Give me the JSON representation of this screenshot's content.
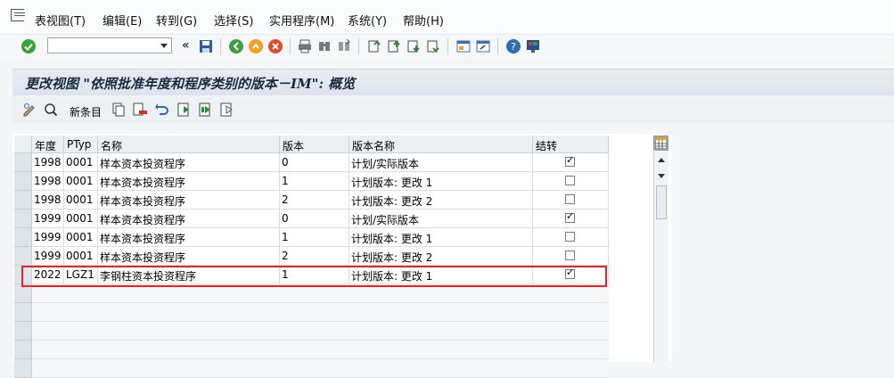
{
  "menu": [
    "表视图(T)",
    "编辑(E)",
    "转到(G)",
    "选择(S)",
    "实用程序(M)",
    "系统(Y)",
    "帮助(H)"
  ],
  "toolbar": {
    "back_chevron": "«"
  },
  "title": "更改视图 \"依照批准年度和程序类别的版本－IM\": 概览",
  "app_toolbar": {
    "new_entries": "新条目"
  },
  "table": {
    "headers": [
      "年度",
      "PTyp",
      "名称",
      "版本",
      "版本名称",
      "结转"
    ],
    "rows": [
      {
        "year": "1998",
        "ptyp": "0001",
        "name": "样本资本投资程序",
        "version": "0",
        "version_name": "计划/实际版本",
        "carry": true
      },
      {
        "year": "1998",
        "ptyp": "0001",
        "name": "样本资本投资程序",
        "version": "1",
        "version_name": "计划版本: 更改 1",
        "carry": false
      },
      {
        "year": "1998",
        "ptyp": "0001",
        "name": "样本资本投资程序",
        "version": "2",
        "version_name": "计划版本: 更改 2",
        "carry": false
      },
      {
        "year": "1999",
        "ptyp": "0001",
        "name": "样本资本投资程序",
        "version": "0",
        "version_name": "计划/实际版本",
        "carry": true
      },
      {
        "year": "1999",
        "ptyp": "0001",
        "name": "样本资本投资程序",
        "version": "1",
        "version_name": "计划版本: 更改 1",
        "carry": false
      },
      {
        "year": "1999",
        "ptyp": "0001",
        "name": "样本资本投资程序",
        "version": "2",
        "version_name": "计划版本: 更改 2",
        "carry": false
      },
      {
        "year": "2022",
        "ptyp": "LGZ1",
        "name": "李钢柱资本投资程序",
        "version": "1",
        "version_name": "计划版本: 更改 1",
        "carry": true
      }
    ]
  },
  "colors": {
    "highlight": "#e8212a",
    "title_bar": "#dbe3ec"
  }
}
